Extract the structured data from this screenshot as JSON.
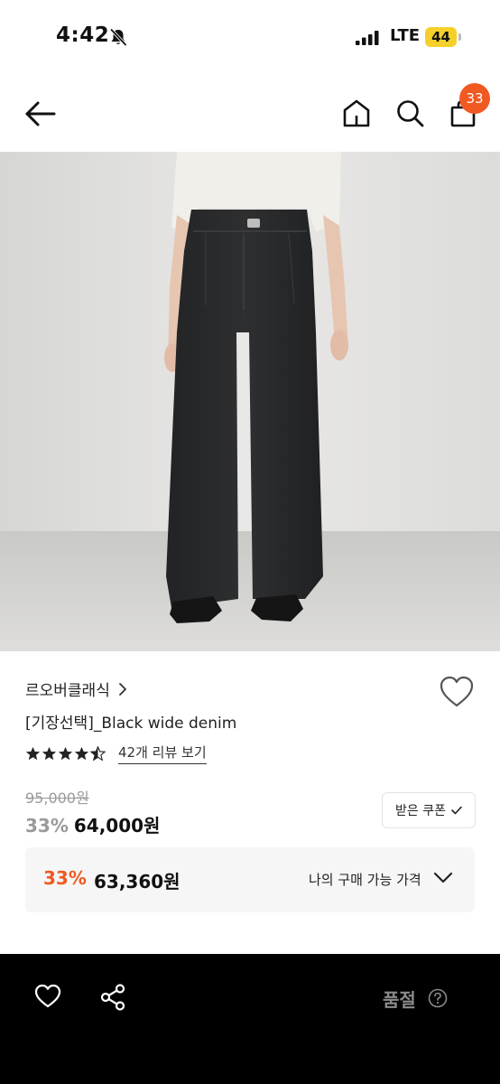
{
  "status_bar": {
    "time": "4:42",
    "network": "LTE",
    "battery": "44"
  },
  "header": {
    "cart_count": "33",
    "icons": [
      "back-icon",
      "home-icon",
      "search-icon",
      "cart-icon"
    ]
  },
  "product": {
    "brand": "르오버클래식",
    "name": "[기장선택]_Black wide denim",
    "rating": 4.5,
    "review_link": "42개 리뷰 보기",
    "original_price": "95,000원",
    "discount_rate": "33%",
    "sale_price": "64,000원",
    "coupon_label": "받은 쿠폰"
  },
  "my_price": {
    "discount_rate": "33%",
    "price": "63,360원",
    "label": "나의 구매 가능 가격"
  },
  "bottom_bar": {
    "soldout_label": "품절",
    "icons": [
      "heart-icon",
      "share-icon",
      "help-icon"
    ]
  },
  "colors": {
    "accent": "#f05a22",
    "bottom_bar": "#000000",
    "battery": "#f5d02b"
  }
}
